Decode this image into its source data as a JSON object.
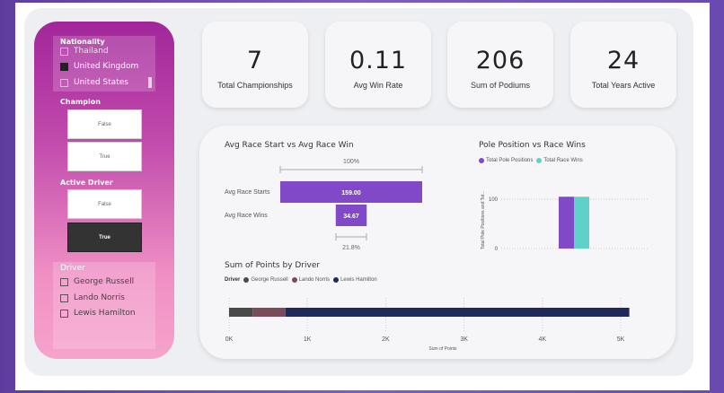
{
  "filters": {
    "nationality": {
      "title": "Nationality",
      "items": [
        {
          "label": "Thailand",
          "checked": false
        },
        {
          "label": "United Kingdom",
          "checked": true
        },
        {
          "label": "United States",
          "checked": false
        }
      ]
    },
    "champion": {
      "title": "Champion",
      "options": [
        {
          "label": "False",
          "selected": false
        },
        {
          "label": "True",
          "selected": false
        }
      ]
    },
    "active_driver": {
      "title": "Active Driver",
      "options": [
        {
          "label": "False",
          "selected": false
        },
        {
          "label": "True",
          "selected": true
        }
      ]
    },
    "driver": {
      "title": "Driver",
      "items": [
        {
          "label": "George Russell",
          "checked": false
        },
        {
          "label": "Lando Norris",
          "checked": false
        },
        {
          "label": "Lewis Hamilton",
          "checked": false
        }
      ]
    }
  },
  "kpis": [
    {
      "value": "7",
      "label": "Total Championships"
    },
    {
      "value": "0.11",
      "label": "Avg Win Rate"
    },
    {
      "value": "206",
      "label": "Sum of Podiums"
    },
    {
      "value": "24",
      "label": "Total Years Active"
    }
  ],
  "colors": {
    "purple": "#8149c7",
    "teal": "#5fd1c9",
    "navy": "#1f2a5a",
    "george": "#4a4a4a",
    "lando": "#7b4b5a"
  },
  "chart_data": [
    {
      "type": "bar",
      "title": "Avg Race Start vs Avg Race Win",
      "categories": [
        "Avg Race Starts",
        "Avg Race Wins"
      ],
      "values": [
        159.0,
        34.67
      ],
      "value_labels": [
        "159.00",
        "34.67"
      ],
      "top_percent": "100%",
      "bottom_percent": "21.8%"
    },
    {
      "type": "bar",
      "title": "Pole Position vs Race Wins",
      "series": [
        {
          "name": "Total Pole Positions",
          "values": [
            105
          ]
        },
        {
          "name": "Total Race Wins",
          "values": [
            105
          ]
        }
      ],
      "ylabel": "Total Pole Positions and Tot...",
      "yticks": [
        "100",
        "0"
      ],
      "ylim": [
        0,
        150
      ]
    },
    {
      "type": "bar",
      "title": "Sum of Points by Driver",
      "legend_title": "Driver",
      "series": [
        {
          "name": "George Russell",
          "value": 300
        },
        {
          "name": "Lando Norris",
          "value": 420
        },
        {
          "name": "Lewis Hamilton",
          "value": 4390
        }
      ],
      "xticks": [
        "0K",
        "1K",
        "2K",
        "3K",
        "4K",
        "5K"
      ],
      "xlim": [
        0,
        5000
      ],
      "xlabel": "Sum of Points"
    }
  ]
}
